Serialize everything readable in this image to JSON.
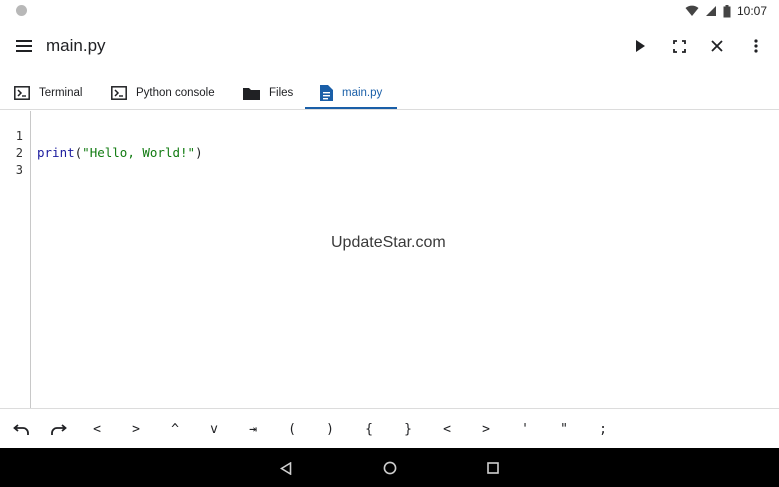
{
  "status_bar": {
    "time": "10:07"
  },
  "app_bar": {
    "title": "main.py",
    "actions": [
      "play-icon",
      "fullscreen-icon",
      "close-icon",
      "more-vert-icon"
    ]
  },
  "tabs": [
    {
      "label": "Terminal",
      "icon": "terminal-icon",
      "active": false
    },
    {
      "label": "Python console",
      "icon": "terminal-icon",
      "active": false
    },
    {
      "label": "Files",
      "icon": "folder-icon",
      "active": false
    },
    {
      "label": "main.py",
      "icon": "file-icon",
      "active": true
    }
  ],
  "editor": {
    "line_numbers": [
      "1",
      "2",
      "3"
    ],
    "code": {
      "line2_fn": "print",
      "line2_open": "(",
      "line2_string": "\"Hello, World!\"",
      "line2_close": ")"
    }
  },
  "watermark": "UpdateStar.com",
  "extra_keys": {
    "undo": "undo-icon",
    "redo": "redo-icon",
    "symbols": [
      "<",
      ">",
      "^",
      "v",
      "⇥",
      "(",
      ")",
      "{",
      "}",
      "<",
      ">",
      "'",
      "\"",
      ";"
    ]
  },
  "colors": {
    "accent": "#1a5fa8",
    "code_function": "#1b1b9e",
    "code_string": "#117b11"
  }
}
